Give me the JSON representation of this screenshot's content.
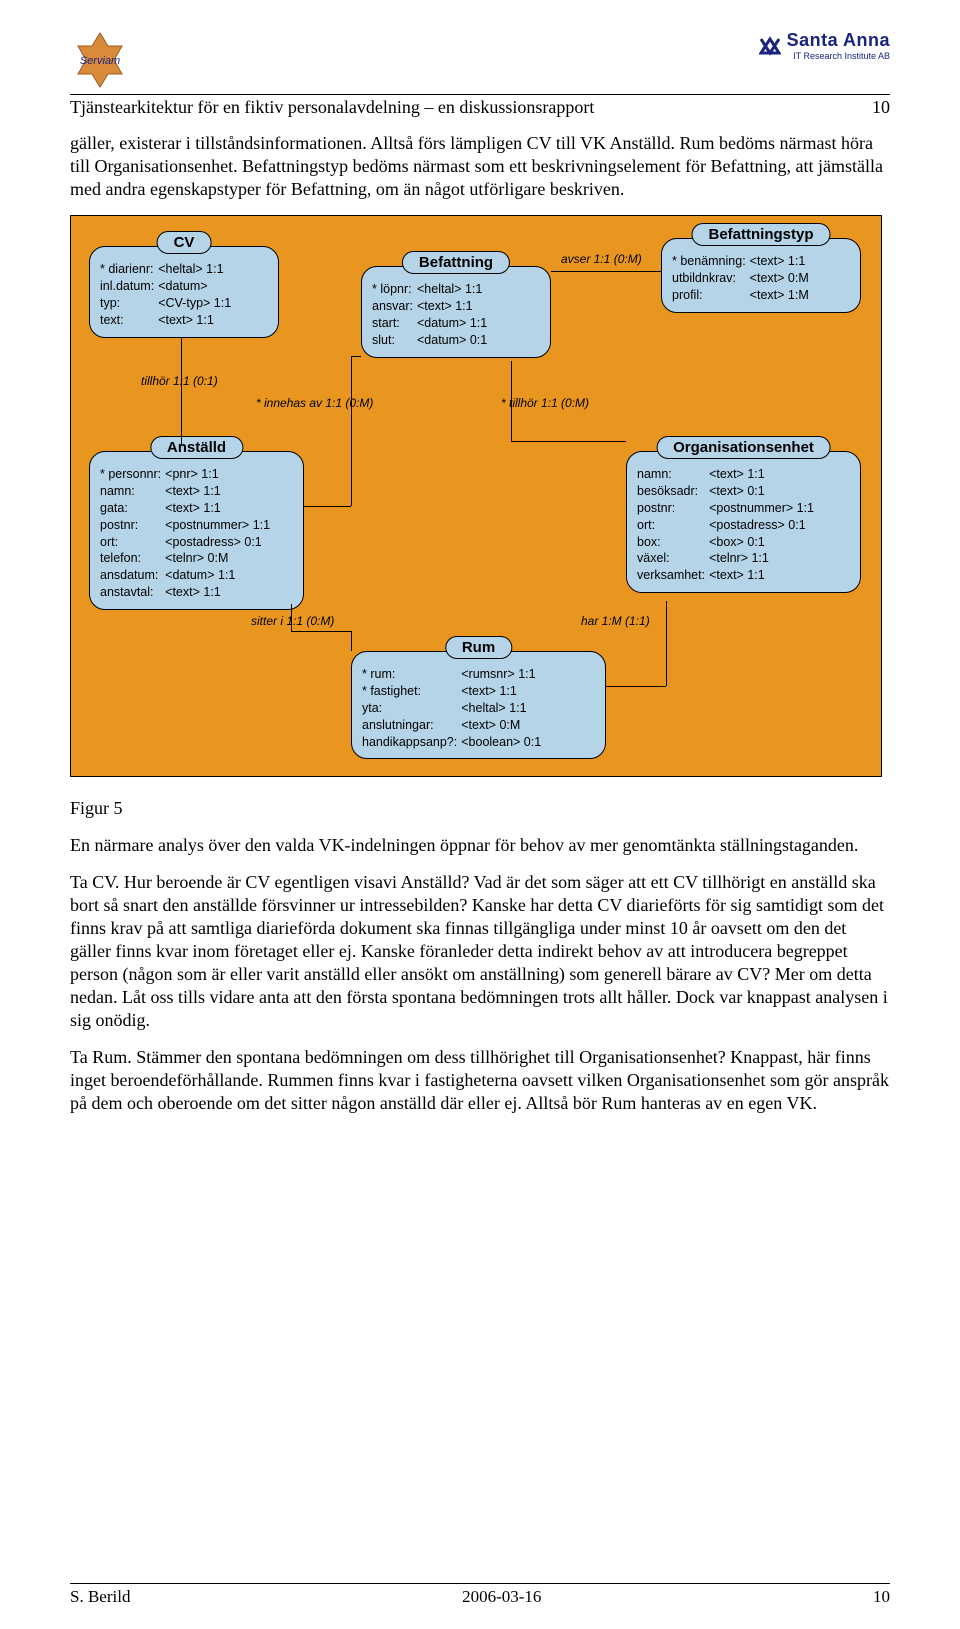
{
  "header": {
    "title": "Tjänstearkitektur för en fiktiv personalavdelning – en diskussionsrapport",
    "page_no": "10",
    "logo_left": "Serviam",
    "logo_right_name": "Santa Anna",
    "logo_right_sub": "IT Research Institute AB"
  },
  "intro_para": "gäller, existerar i tillståndsinformationen. Alltså förs lämpligen CV till VK Anställd. Rum bedöms närmast höra till Organisationsenhet. Befattningstyp bedöms närmast som ett beskrivningselement för Befattning, att jämställa med andra egenskapstyper för Befattning, om än något utförligare beskriven.",
  "diagram": {
    "entities": {
      "cv": {
        "name": "CV",
        "rows": [
          [
            "* diarienr:",
            "<heltal> 1:1"
          ],
          [
            "  inl.datum:",
            "<datum>"
          ],
          [
            "  typ:",
            "<CV-typ> 1:1"
          ],
          [
            "  text:",
            "<text> 1:1"
          ]
        ]
      },
      "befattning": {
        "name": "Befattning",
        "rows": [
          [
            "* löpnr:",
            "<heltal> 1:1"
          ],
          [
            "  ansvar:",
            "<text> 1:1"
          ],
          [
            "  start:",
            "<datum> 1:1"
          ],
          [
            "  slut:",
            "<datum> 0:1"
          ]
        ]
      },
      "befattningstyp": {
        "name": "Befattningstyp",
        "rows": [
          [
            "* benämning:",
            "<text> 1:1"
          ],
          [
            "  utbildnkrav:",
            "<text> 0:M"
          ],
          [
            "  profil:",
            "<text> 1:M"
          ]
        ]
      },
      "anstalld": {
        "name": "Anställd",
        "rows": [
          [
            "* personnr:",
            "<pnr> 1:1"
          ],
          [
            "  namn:",
            "<text> 1:1"
          ],
          [
            "  gata:",
            "<text> 1:1"
          ],
          [
            "  postnr:",
            "<postnummer> 1:1"
          ],
          [
            "  ort:",
            "<postadress> 0:1"
          ],
          [
            "  telefon:",
            "<telnr> 0:M"
          ],
          [
            "  ansdatum:",
            "<datum> 1:1"
          ],
          [
            "  anstavtal:",
            "<text> 1:1"
          ]
        ]
      },
      "organisationsenhet": {
        "name": "Organisationsenhet",
        "rows": [
          [
            "  namn:",
            "<text> 1:1"
          ],
          [
            "  besöksadr:",
            "<text> 0:1"
          ],
          [
            "  postnr:",
            "<postnummer> 1:1"
          ],
          [
            "  ort:",
            "<postadress> 0:1"
          ],
          [
            "  box:",
            "<box> 0:1"
          ],
          [
            "  växel:",
            "<telnr> 1:1"
          ],
          [
            "  verksamhet:",
            "<text> 1:1"
          ]
        ]
      },
      "rum": {
        "name": "Rum",
        "rows": [
          [
            "* rum:",
            "<rumsnr> 1:1"
          ],
          [
            "* fastighet:",
            "<text> 1:1"
          ],
          [
            "  yta:",
            "<heltal> 1:1"
          ],
          [
            "  anslutningar:",
            "<text> 0:M"
          ],
          [
            "  handikappsanp?:",
            "<boolean> 0:1"
          ]
        ]
      }
    },
    "relations": {
      "tillhor1": "tillhör 1:1 (0:1)",
      "innehas": "* innehas av 1:1 (0:M)",
      "avser": "avser 1:1 (0:M)",
      "tillhor2": "* tillhör 1:1 (0:M)",
      "sitter": "sitter i 1:1 (0:M)",
      "har": "har 1:M (1:1)"
    }
  },
  "figure_label": "Figur 5",
  "para2": "En närmare analys över den valda VK-indelningen öppnar för behov av mer genomtänkta ställningstaganden.",
  "para3": "Ta CV. Hur beroende är CV egentligen visavi Anställd? Vad är det som säger att ett CV tillhörigt en anställd ska bort så snart den anställde försvinner ur intressebilden? Kanske har detta CV diarieförts för sig samtidigt som det finns krav på att samtliga diarieförda dokument ska finnas tillgängliga under minst 10 år oavsett om den det gäller finns kvar inom företaget eller ej. Kanske föranleder detta indirekt behov av att introducera begreppet person (någon som är eller varit anställd eller ansökt om anställning) som generell bärare av CV? Mer om detta nedan. Låt oss tills vidare anta att den första spontana bedömningen trots allt håller. Dock var knappast analysen i sig onödig.",
  "para4": "Ta Rum. Stämmer den spontana bedömningen om dess tillhörighet till Organisationsenhet? Knappast, här finns inget beroendeförhållande. Rummen finns kvar i fastigheterna oavsett vilken Organisationsenhet som gör anspråk på dem och oberoende om det sitter någon anställd där eller ej. Alltså bör Rum hanteras av en egen VK.",
  "footer": {
    "author": "S. Berild",
    "date": "2006-03-16",
    "page": "10"
  }
}
